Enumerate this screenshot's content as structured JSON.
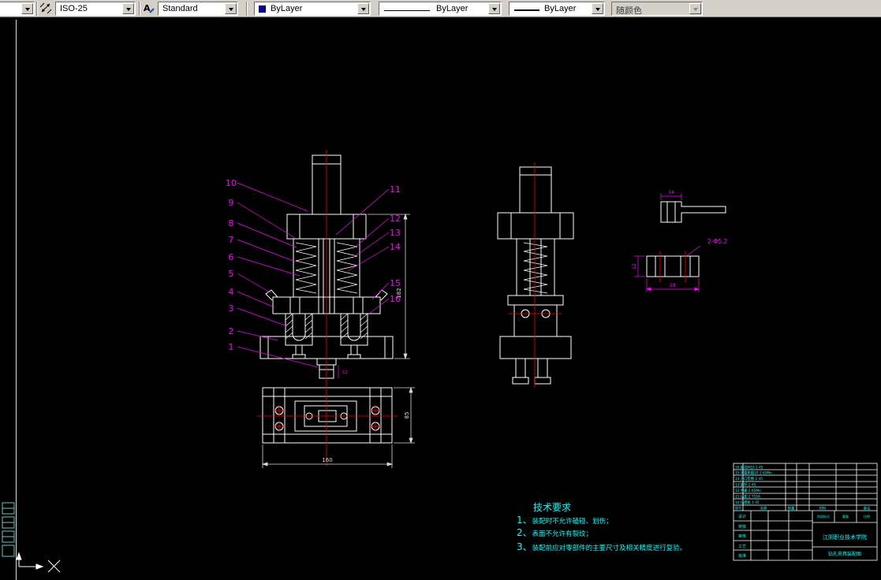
{
  "toolbar": {
    "dim_style_value": "ISO-25",
    "text_style_value": "Standard",
    "color_value": "ByLayer",
    "linetype_value": "ByLayer",
    "lineweight_value": "ByLayer",
    "plot_style_value": "随颜色"
  },
  "icons": {
    "text_style_glyph": "A"
  },
  "colors": {
    "background": "#000000",
    "geometry": "#ffffff",
    "centerline": "#ff0000",
    "annotation": "#ff00ff",
    "notes": "#00ffff",
    "toolbar_bg": "#d4d0c8",
    "color_swatch": "#0000b8"
  },
  "drawing": {
    "callouts_left": [
      "10",
      "9",
      "8",
      "7",
      "6",
      "5",
      "4",
      "3",
      "2",
      "1"
    ],
    "callouts_right": [
      "11",
      "12",
      "13",
      "14",
      "15",
      "16"
    ],
    "dims": {
      "hole_note": "2-Φ5.2",
      "detail_width": "28",
      "detail_height": "12",
      "clamp_len": "14",
      "front_height": "182",
      "plan_width": "160",
      "plan_depth": "85",
      "stub": "12"
    }
  },
  "tech": {
    "title": "技术要求",
    "item1_num": "1、",
    "item1_text": "装配时不允许磕碰、划伤；",
    "item2_num": "2、",
    "item2_text": "表面不允许有裂纹；",
    "item3_num": "3、",
    "item3_text": "装配前应对零部件的主要尺寸及相关精度进行复验。"
  },
  "title_block": {
    "school": "江阴职业技术学院",
    "drawing_title": "钻孔夹具装配图",
    "sign_rows": [
      "设计",
      "校核",
      "审核",
      "工艺",
      "批准"
    ],
    "header_cols": [
      "序号",
      "名称",
      "数量",
      "材料",
      "备注"
    ],
    "right_labels": [
      "阶段标记",
      "重量",
      "比例"
    ],
    "parts": [
      "16 螺母M10 2 45",
      "15 弹簧垫圈10 2 65Mn",
      "14 开口垫圈 2 45",
      "13 螺杆 2 45",
      "12 弹簧 2 65Mn",
      "11 钻套 2 T10A",
      "10 钻模板 1 45"
    ]
  }
}
